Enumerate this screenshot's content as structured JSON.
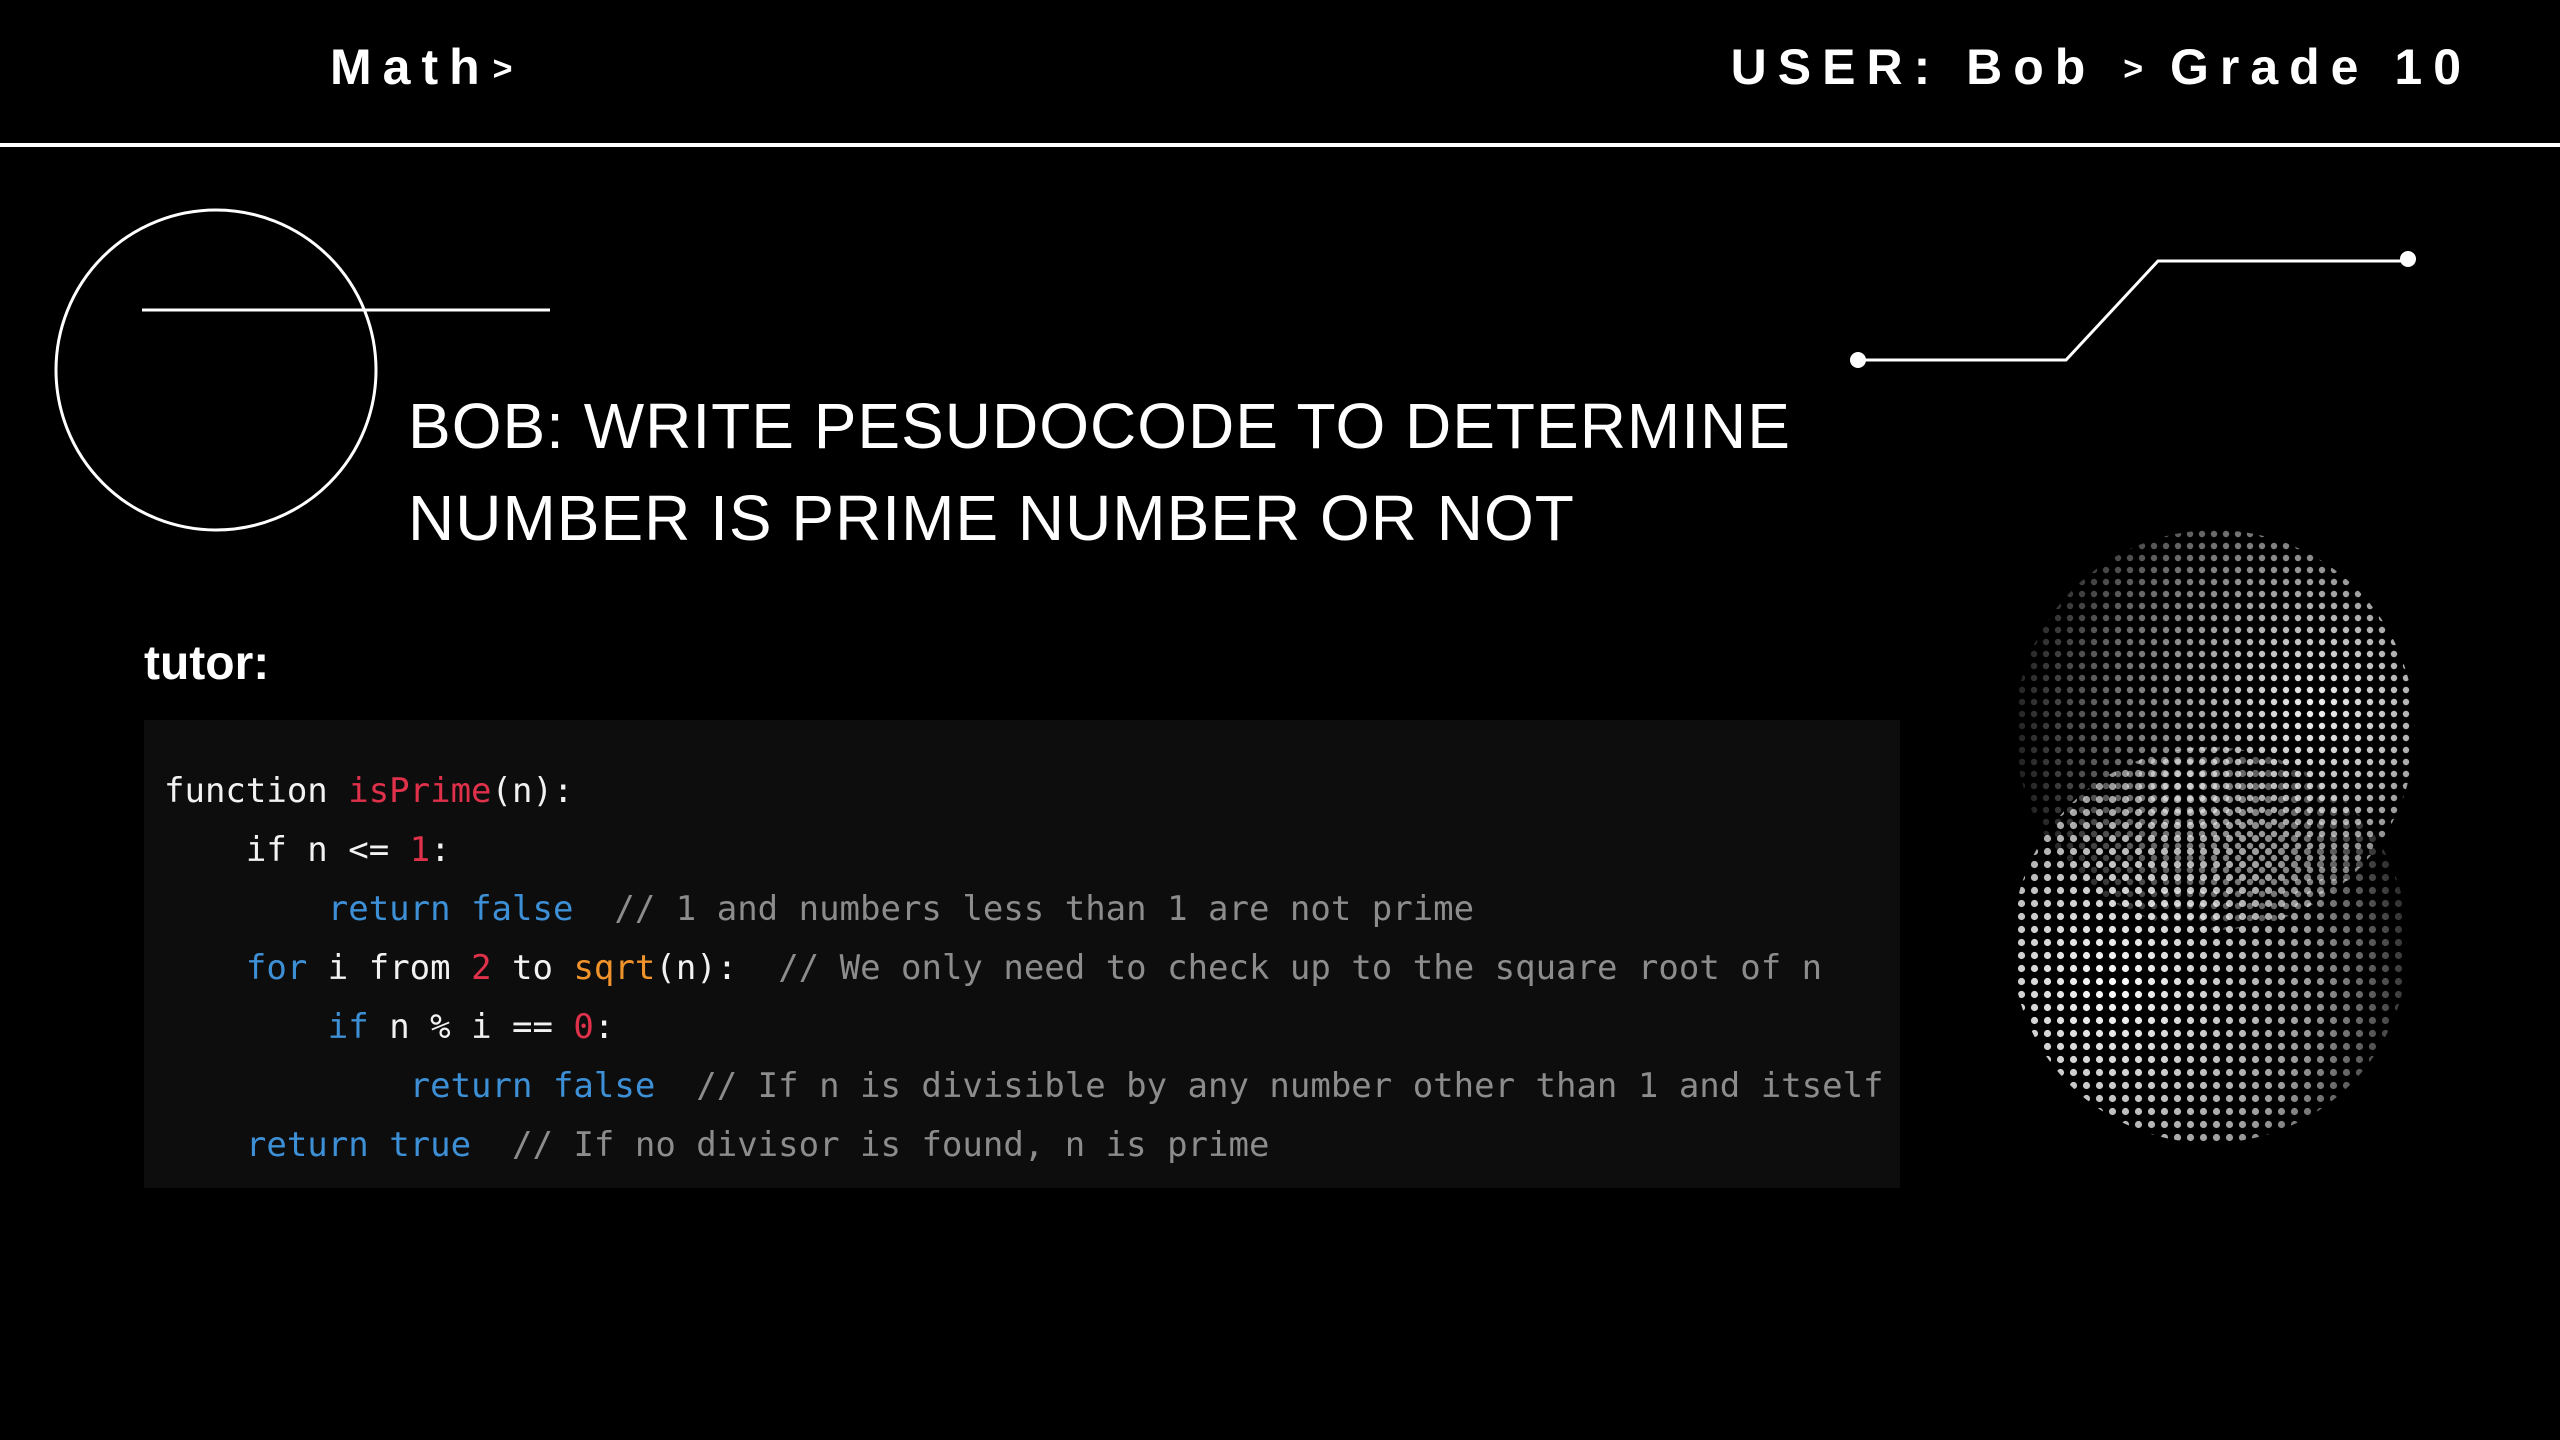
{
  "header": {
    "subject": "Math",
    "user_label": "USER: Bob",
    "grade": "Grade 10",
    "separator": ">"
  },
  "question": {
    "line1": "BOB: WRITE PESUDOCODE TO DETERMINE",
    "line2": "NUMBER IS PRIME NUMBER OR NOT"
  },
  "tutor": {
    "label": "tutor:"
  },
  "code": {
    "l1": {
      "a": "function ",
      "b": "isPrime",
      "c": "(n):"
    },
    "l2": {
      "a": "if n <= ",
      "b": "1",
      "c": ":"
    },
    "l3": {
      "kw1": "return",
      "kw2": "false",
      "comment": "// 1 and numbers less than 1 are not prime"
    },
    "l4": {
      "kw": "for",
      "a": " i from ",
      "n": "2",
      "b": " to ",
      "call": "sqrt",
      "c": "(n):",
      "comment": "// We only need to check up to the square root of n"
    },
    "l5": {
      "kw": "if",
      "a": " n % i == ",
      "n": "0",
      "c": ":"
    },
    "l6": {
      "kw1": "return",
      "kw2": "false",
      "comment": "// If n is divisible by any number other than 1 and itself"
    },
    "l7": {
      "kw1": "return",
      "kw2": "true",
      "comment": "// If no divisor is found, n is prime"
    }
  },
  "colors": {
    "background": "#000000",
    "code_background": "#0d0d0d",
    "keyword": "#3d8fd6",
    "function_name": "#e0314b",
    "number": "#e0314b",
    "call": "#f0932b",
    "comment": "#8c8c8c"
  },
  "icons": [
    "circle-decoration",
    "connector-line-decoration",
    "dotted-sphere-graphic"
  ]
}
